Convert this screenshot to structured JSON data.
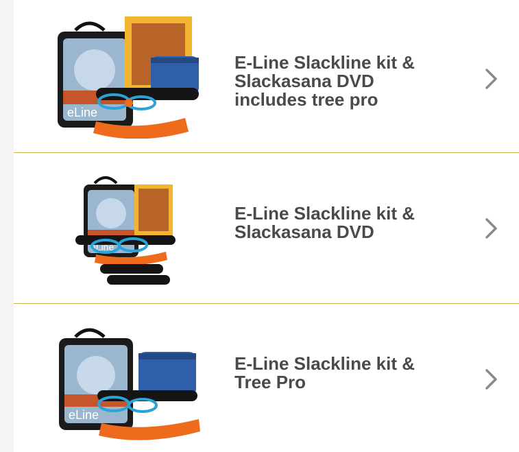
{
  "products": [
    {
      "title_line1": "E-Line Slackline kit &",
      "title_line2": "Slackasana DVD",
      "title_line3": "includes tree pro",
      "image": "kit-bag-dvd-treepro",
      "action_icon": "chevron-right-icon"
    },
    {
      "title_line1": "E-Line Slackline kit &",
      "title_line2": "Slackasana DVD",
      "image": "kit-bag-dvd",
      "action_icon": "chevron-right-icon"
    },
    {
      "title_line1": "E-Line Slackline kit &",
      "title_line2": "Tree Pro",
      "image": "kit-bag-treepro",
      "action_icon": "chevron-right-icon"
    }
  ],
  "colors": {
    "title": "#4a4a4a",
    "divider": "#c9b44a",
    "chevron": "#8a8a8a",
    "slackline_orange": "#ee6a1c",
    "treepro_blue": "#2f5fa8"
  }
}
